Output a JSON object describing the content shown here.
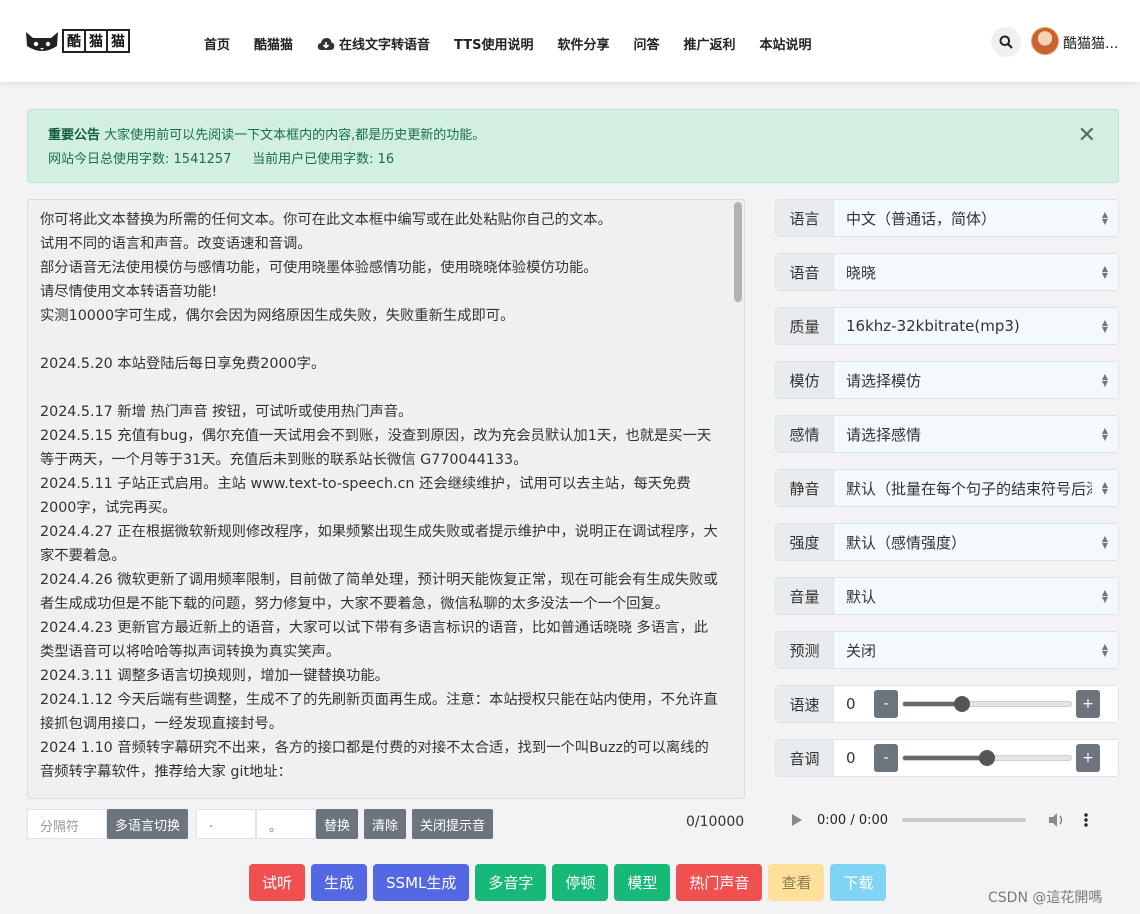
{
  "nav": {
    "logo_chars": [
      "酷",
      "猫",
      "猫"
    ],
    "items": [
      "首页",
      "酷猫猫",
      "在线文字转语音",
      "TTS使用说明",
      "软件分享",
      "问答",
      "推广返利",
      "本站说明"
    ],
    "username": "酷猫猫..."
  },
  "alert": {
    "title": "重要公告",
    "message": "大家使用前可以先阅读一下文本框内的内容,都是历史更新的功能。",
    "stats_label_total": "网站今日总使用字数:",
    "stats_total": "1541257",
    "stats_label_user": "当前用户已使用字数:",
    "stats_user": "16",
    "close": "✕"
  },
  "editor": {
    "lines": [
      "你可将此文本替换为所需的任何文本。你可在此文本框中编写或在此处粘贴你自己的文本。",
      "试用不同的语言和声音。改变语速和音调。",
      "部分语音无法使用模仿与感情功能，可使用晓墨体验感情功能，使用晓晓体验模仿功能。",
      "请尽情使用文本转语音功能!",
      "实测10000字可生成，偶尔会因为网络原因生成失败，失败重新生成即可。",
      "",
      "2024.5.20 本站登陆后每日享免费2000字。",
      "",
      "2024.5.17 新增 热门声音 按钮，可试听或使用热门声音。",
      "2024.5.15 充值有bug，偶尔充值一天试用会不到账，没查到原因，改为充会员默认加1天，也就是买一天等于两天，一个月等于31天。充值后未到账的联系站长微信 G770044133。",
      "2024.5.11 子站正式启用。主站 www.text-to-speech.cn 还会继续维护，试用可以去主站，每天免费2000字，试完再买。",
      "2024.4.27 正在根据微软新规则修改程序，如果频繁出现生成失败或者提示维护中，说明正在调试程序，大家不要着急。",
      "2024.4.26 微软更新了调用频率限制，目前做了简单处理，预计明天能恢复正常，现在可能会有生成失败或者生成成功但是不能下载的问题，努力修复中，大家不要着急，微信私聊的太多没法一个一个回复。",
      "2024.4.23 更新官方最近新上的语音，大家可以试下带有多语言标识的语音，比如普通话晓晓 多语言，此类型语音可以将哈哈等拟声词转换为真实笑声。",
      "2024.3.11 调整多语言切换规则，增加一键替换功能。",
      "2024.1.12 今天后端有些调整，生成不了的先刷新页面再生成。注意：本站授权只能在站内使用，不允许直接抓包调用接口，一经发现直接封号。",
      "2024 1.10 音频转字幕研究不出来，各方的接口都是付费的对接不太合适，找到一个叫Buzz的可以离线的音频转字幕软件，推荐给大家 git地址："
    ],
    "separator_placeholder": "分隔符",
    "multi_lang_btn": "多语言切换",
    "input_a": ".",
    "input_b": "。",
    "replace_btn": "替换",
    "clear_btn": "清除",
    "close_tip_btn": "关闭提示音",
    "count": "0/10000"
  },
  "options": [
    {
      "label": "语言",
      "value": "中文（普通话，简体）"
    },
    {
      "label": "语音",
      "value": "晓晓"
    },
    {
      "label": "质量",
      "value": "16khz-32kbitrate(mp3)"
    },
    {
      "label": "模仿",
      "value": "请选择模仿"
    },
    {
      "label": "感情",
      "value": "请选择感情"
    },
    {
      "label": "静音",
      "value": "默认（批量在每个句子的结束符号后添加静音）"
    },
    {
      "label": "强度",
      "value": "默认（感情强度）"
    },
    {
      "label": "音量",
      "value": "默认"
    },
    {
      "label": "预测",
      "value": "关闭"
    }
  ],
  "sliders": [
    {
      "label": "语速",
      "value": "0",
      "minus": "-",
      "plus": "+",
      "level": 0.35
    },
    {
      "label": "音调",
      "value": "0",
      "minus": "-",
      "plus": "+",
      "level": 0.5
    }
  ],
  "audio": {
    "time": "0:00 / 0:00"
  },
  "actions": [
    {
      "label": "试听",
      "color": "#f05050"
    },
    {
      "label": "生成",
      "color": "#5468e4"
    },
    {
      "label": "SSML生成",
      "color": "#5468e4"
    },
    {
      "label": "多音字",
      "color": "#16b978"
    },
    {
      "label": "停顿",
      "color": "#16b978"
    },
    {
      "label": "模型",
      "color": "#16b978"
    },
    {
      "label": "热门声音",
      "color": "#f05050"
    },
    {
      "label": "查看",
      "color": "#fde19a"
    },
    {
      "label": "下载",
      "color": "#7fd3f3"
    }
  ],
  "watermark": "CSDN @這花開嗎"
}
